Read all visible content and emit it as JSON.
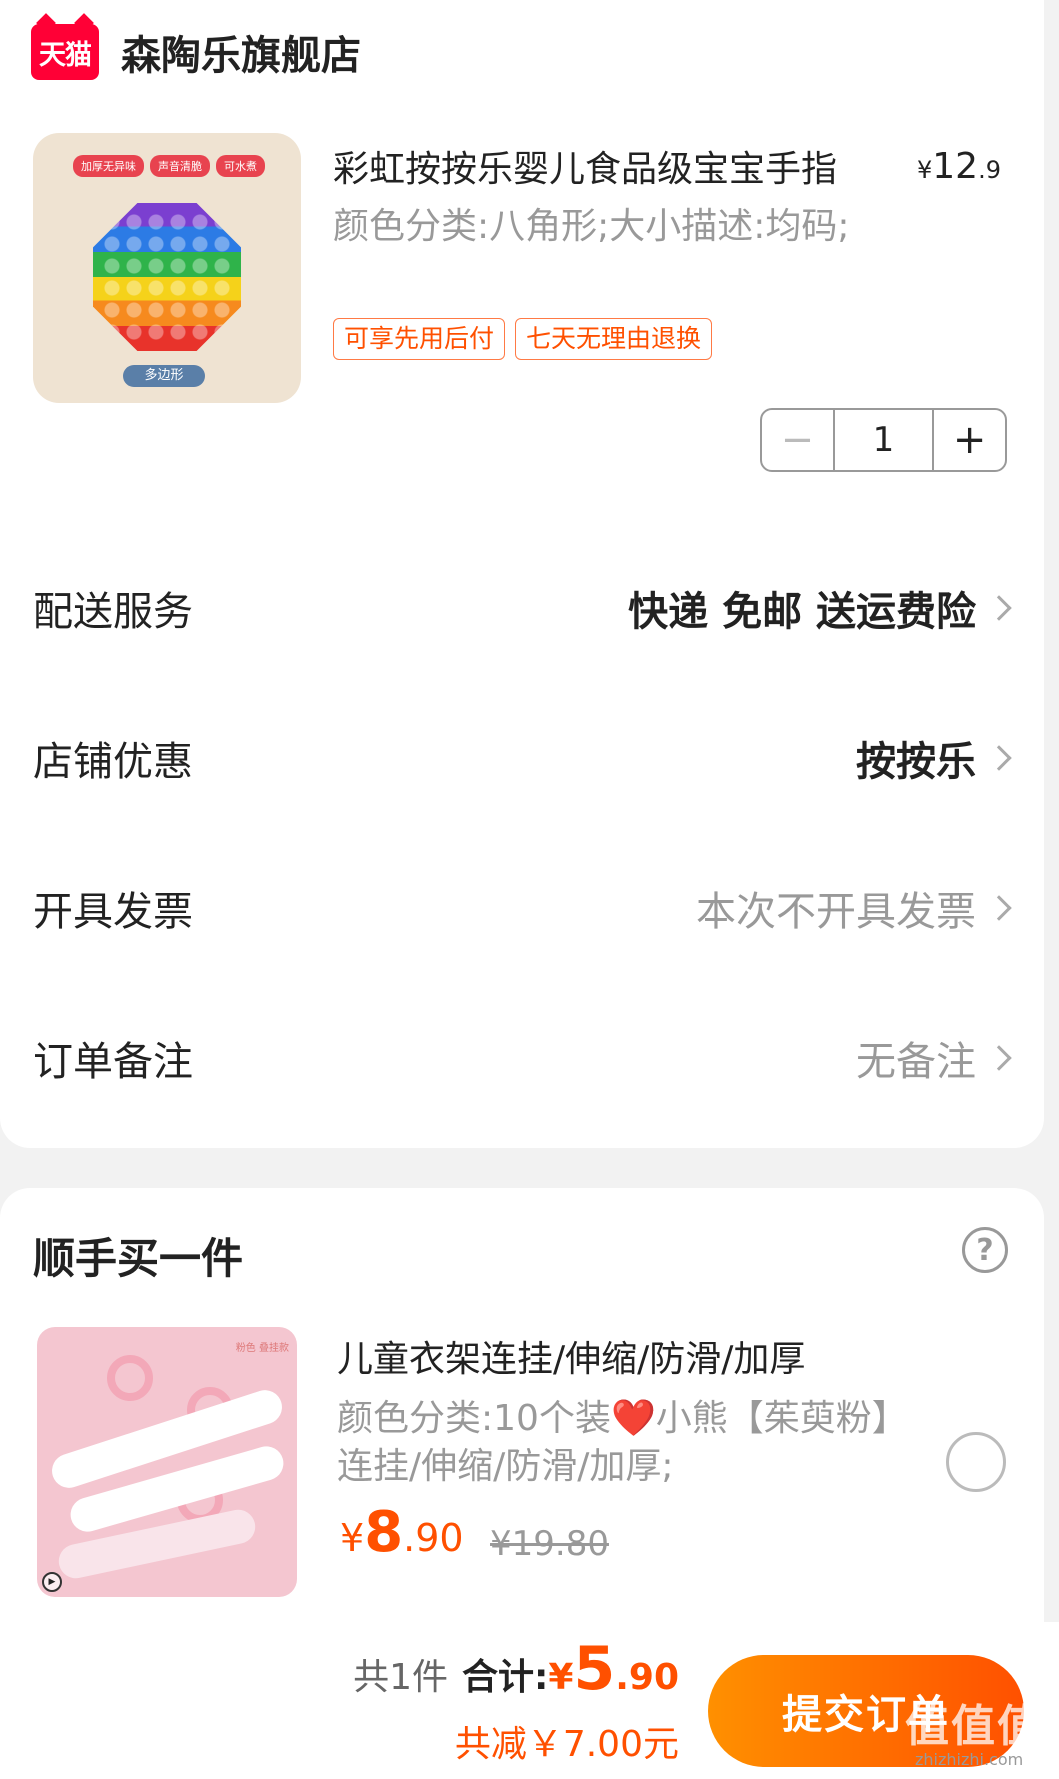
{
  "store": {
    "logo_text": "天猫",
    "name": "森陶乐旗舰店"
  },
  "product": {
    "image_pills": [
      "加厚无异味",
      "声音清脆",
      "可水煮"
    ],
    "image_shape_label": "多边形",
    "title": "彩虹按按乐婴儿食品级宝宝手指",
    "price_currency": "¥",
    "price_int": "12",
    "price_dec": ".9",
    "spec": "颜色分类:八角形;大小描述:均码;",
    "tags": [
      "可享先用后付",
      "七天无理由退换"
    ],
    "quantity": "1",
    "minus_symbol": "−",
    "plus_symbol": "+"
  },
  "rows": [
    {
      "label": "配送服务",
      "value": "快递 免邮 送运费险",
      "style": "bold"
    },
    {
      "label": "店铺优惠",
      "value": "按按乐",
      "style": "bold"
    },
    {
      "label": "开具发票",
      "value": "本次不开具发票",
      "style": "muted"
    },
    {
      "label": "订单备注",
      "value": "无备注",
      "style": "muted"
    }
  ],
  "upsell": {
    "section_title": "顺手买一件",
    "help_symbol": "?",
    "image_badge": "粉色 叠挂款",
    "title": "儿童衣架连挂/伸缩/防滑/加厚",
    "spec": "颜色分类:10个装❤️小熊【茱萸粉】连挂/伸缩/防滑/加厚;",
    "price_currency": "¥",
    "price_int": "8",
    "price_dec": ".90",
    "original_price": "¥19.80"
  },
  "footer": {
    "count_text": "共1件",
    "total_label": "合计:",
    "total_currency": "¥",
    "total_int": "5",
    "total_dec": ".90",
    "discount_text": "共减￥7.00元",
    "submit_label": "提交订单",
    "watermark": "值值值",
    "watermark_url": "zhizhizhi.com"
  },
  "colors": {
    "accent": "#ff5000",
    "tmall_red": "#ff0036",
    "muted_text": "#999999"
  }
}
